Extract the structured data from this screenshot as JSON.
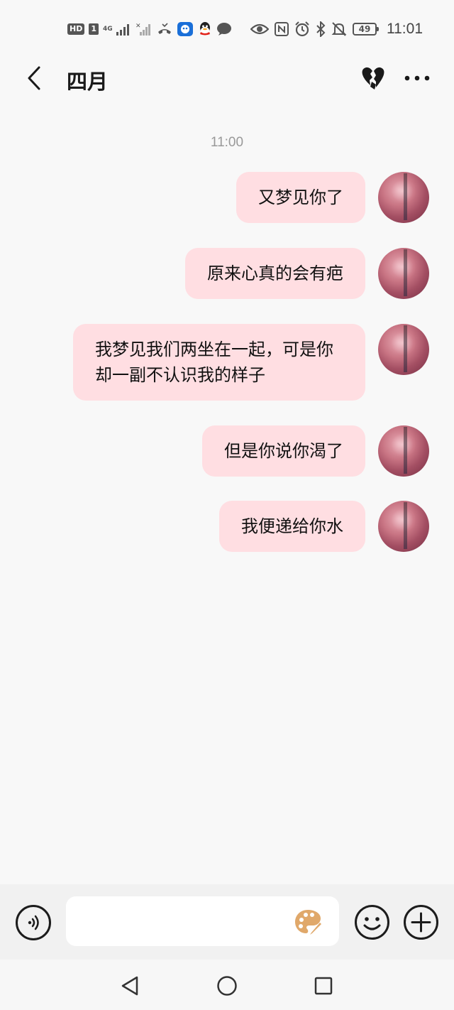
{
  "status_bar": {
    "hd_label": "HD",
    "sim_label": "1",
    "network_1": "4G",
    "battery_level": "49",
    "time": "11:01",
    "icons": [
      "signal-icon",
      "no-signal-icon",
      "missed-call-icon",
      "app-notification-icon",
      "qq-icon",
      "message-icon",
      "eye-icon",
      "nfc-icon",
      "alarm-icon",
      "bluetooth-icon",
      "mute-icon",
      "battery-icon"
    ]
  },
  "header": {
    "title": "四月",
    "icons": [
      "back-arrow-icon",
      "broken-heart-icon",
      "more-icon"
    ]
  },
  "chat": {
    "timestamp": "11:00",
    "messages": [
      {
        "text": "又梦见你了",
        "sender": "me"
      },
      {
        "text": "原来心真的会有疤",
        "sender": "me"
      },
      {
        "text": "我梦见我们两坐在一起，可是你却一副不认识我的样子",
        "sender": "me"
      },
      {
        "text": "但是你说你渴了",
        "sender": "me"
      },
      {
        "text": "我便递给你水",
        "sender": "me"
      }
    ]
  },
  "input_bar": {
    "value": "",
    "icons": [
      "voice-icon",
      "palette-icon",
      "emoji-icon",
      "plus-icon"
    ]
  },
  "nav_bar": {
    "icons": [
      "back-triangle-icon",
      "home-circle-icon",
      "recents-square-icon"
    ]
  },
  "colors": {
    "background": "#f8f8f8",
    "bubble": "#ffdee2",
    "input_bar": "#f1f1f1",
    "palette_accent": "#e0a86a"
  }
}
